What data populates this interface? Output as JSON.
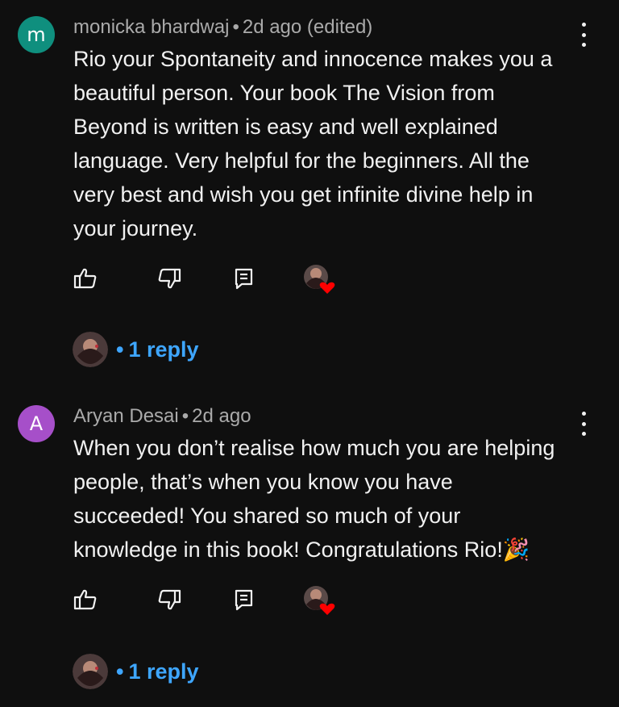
{
  "comments": [
    {
      "avatar_letter": "m",
      "avatar_color": "#0f8f7e",
      "author": "monicka bhardwaj",
      "separator": "•",
      "time": "2d ago (edited)",
      "lines": [
        "Rio your Spontaneity and innocence makes you a",
        "beautiful person. Your book The Vision from",
        "Beyond is written is easy and well explained",
        "language. Very helpful for the beginners. All the",
        "very best and wish you get infinite divine help in",
        "your journey."
      ],
      "reply_bullet": "•",
      "reply_label": "1 reply"
    },
    {
      "avatar_letter": "A",
      "avatar_color": "#a64fc9",
      "author": "Aryan Desai",
      "separator": "•",
      "time": "2d ago",
      "lines": [
        "When you don’t realise how much you are helping",
        "people, that’s when you know you have",
        "succeeded! You shared so much of your",
        "knowledge in this book! Congratulations Rio!🎉"
      ],
      "reply_bullet": "•",
      "reply_label": "1 reply"
    }
  ],
  "icons": {
    "like": "thumbs-up-icon",
    "dislike": "thumbs-down-icon",
    "reply": "comment-icon",
    "more": "more-vert-icon",
    "hearted": "creator-heart-icon"
  },
  "colors": {
    "background": "#0f0f0f",
    "text": "#f1f1f1",
    "meta": "#aaaaaa",
    "link": "#3ea6ff",
    "heart": "#ff0000"
  }
}
